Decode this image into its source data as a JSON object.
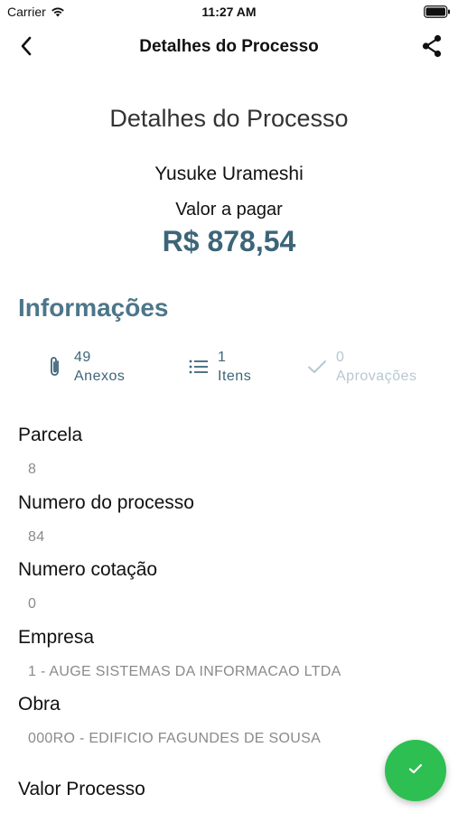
{
  "status_bar": {
    "carrier": "Carrier",
    "time": "11:27 AM"
  },
  "nav": {
    "title": "Detalhes do Processo",
    "back_icon": "chevron-left-icon",
    "share_icon": "share-icon"
  },
  "header": {
    "heading": "Detalhes do Processo",
    "user_name": "Yusuke Urameshi",
    "amount_label": "Valor a pagar",
    "amount_value": "R$ 878,54"
  },
  "section": {
    "title": "Informações"
  },
  "stats": [
    {
      "count": "49",
      "label": "Anexos",
      "icon": "paperclip-icon",
      "enabled": true
    },
    {
      "count": "1",
      "label": "Itens",
      "icon": "list-icon",
      "enabled": true
    },
    {
      "count": "0",
      "label": "Aprovações",
      "icon": "checkmark-icon",
      "enabled": false
    }
  ],
  "fields": [
    {
      "label": "Parcela",
      "value": "8"
    },
    {
      "label": "Numero do processo",
      "value": "84"
    },
    {
      "label": "Numero cotação",
      "value": "0"
    },
    {
      "label": "Empresa",
      "value": "1 - AUGE SISTEMAS DA INFORMACAO LTDA"
    },
    {
      "label": "Obra",
      "value": "000RO - EDIFICIO FAGUNDES DE SOUSA"
    },
    {
      "label": "Valor Processo",
      "value": ""
    }
  ],
  "fab": {
    "icon": "check-icon"
  },
  "colors": {
    "accent": "#3d6579",
    "section_title": "#4d7689",
    "disabled": "#b7c8d0",
    "fab": "#2dbf52",
    "muted_value": "#8a8a8a"
  }
}
